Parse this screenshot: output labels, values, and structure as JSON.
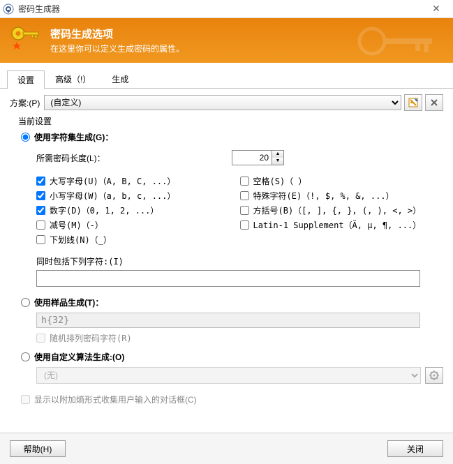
{
  "window": {
    "title": "密码生成器"
  },
  "banner": {
    "heading": "密码生成选项",
    "sub": "在这里你可以定义生成密码的属性。"
  },
  "tabs": {
    "settings": "设置",
    "advanced": "高级（!）",
    "generate": "生成"
  },
  "scheme": {
    "label": "方案:(P)",
    "value": "(自定义)"
  },
  "current_label": "当前设置",
  "radios": {
    "charset": "使用字符集生成(G)：",
    "pattern": "使用样品生成(T)：",
    "algo": "使用自定义算法生成:(O)"
  },
  "length": {
    "label": "所需密码长度(L)：",
    "value": "20"
  },
  "checks_left": [
    {
      "label": "大写字母(U)（A, B, C, ...）",
      "checked": true
    },
    {
      "label": "小写字母(W)（a, b, c, ...）",
      "checked": true
    },
    {
      "label": "数字(D)（0, 1, 2, ...）",
      "checked": true
    },
    {
      "label": "减号(M)（-）",
      "checked": false
    },
    {
      "label": "下划线(N)（_）",
      "checked": false
    }
  ],
  "checks_right": [
    {
      "label": "空格(S)（ ）",
      "checked": false
    },
    {
      "label": "特殊字符(E)（!, $, %, &, ...）",
      "checked": false
    },
    {
      "label": "方括号(B)（[, ], {, }, (, ), <, >）",
      "checked": false
    },
    {
      "label": "Latin-1 Supplement（Ä, µ, ¶, ...）",
      "checked": false
    }
  ],
  "also_include": {
    "label": "同时包括下列字符:(I)",
    "value": ""
  },
  "pattern": {
    "value": "h{32}",
    "shuffle_label": "随机排列密码字符(R)"
  },
  "algo": {
    "value": "(无)"
  },
  "entropy_check": "显示以附加熵形式收集用户输入的对话框(C)",
  "footer": {
    "help": "帮助(H)",
    "close": "关闭"
  }
}
